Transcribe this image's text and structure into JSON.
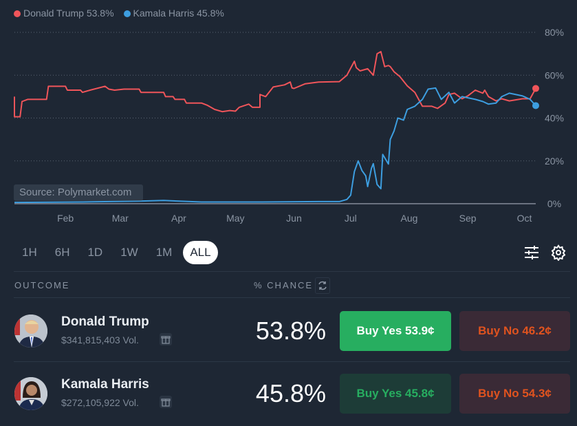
{
  "legend": [
    {
      "label": "Donald Trump 53.8%",
      "color": "#f0555a"
    },
    {
      "label": "Kamala Harris 45.8%",
      "color": "#3d9ee0"
    }
  ],
  "source": "Source: Polymarket.com",
  "chart_data": {
    "type": "line",
    "ylim": [
      0,
      80
    ],
    "yticks": [
      "0%",
      "20%",
      "40%",
      "60%",
      "80%"
    ],
    "ytick_values": [
      0,
      20,
      40,
      60,
      80
    ],
    "xticks": [
      "Feb",
      "Mar",
      "Apr",
      "May",
      "Jun",
      "Jul",
      "Aug",
      "Sep",
      "Oct"
    ],
    "xtick_dates": [
      "2024-02-01",
      "2024-03-01",
      "2024-04-01",
      "2024-05-01",
      "2024-06-01",
      "2024-07-01",
      "2024-08-01",
      "2024-09-01",
      "2024-10-01"
    ],
    "xlim": [
      "2024-01-05",
      "2024-10-07"
    ],
    "grid": true,
    "legend_position": "top-left",
    "series": [
      {
        "name": "Donald Trump",
        "color": "#f0555a",
        "points": [
          [
            "2024-01-05",
            50
          ],
          [
            "2024-01-05",
            40.6
          ],
          [
            "2024-01-08",
            40.6
          ],
          [
            "2024-01-09",
            47.7
          ],
          [
            "2024-01-12",
            48.7
          ],
          [
            "2024-01-22",
            48.7
          ],
          [
            "2024-01-23",
            54.8
          ],
          [
            "2024-02-01",
            54.8
          ],
          [
            "2024-02-02",
            53
          ],
          [
            "2024-02-09",
            53
          ],
          [
            "2024-02-10",
            52
          ],
          [
            "2024-02-14",
            53
          ],
          [
            "2024-02-22",
            54.8
          ],
          [
            "2024-02-24",
            53.5
          ],
          [
            "2024-02-27",
            53
          ],
          [
            "2024-03-03",
            53.5
          ],
          [
            "2024-03-11",
            53.5
          ],
          [
            "2024-03-12",
            52
          ],
          [
            "2024-03-24",
            52
          ],
          [
            "2024-03-25",
            50
          ],
          [
            "2024-03-29",
            50
          ],
          [
            "2024-03-30",
            48.7
          ],
          [
            "2024-04-04",
            48.7
          ],
          [
            "2024-04-05",
            47
          ],
          [
            "2024-04-13",
            47
          ],
          [
            "2024-04-16",
            46
          ],
          [
            "2024-04-20",
            44
          ],
          [
            "2024-04-24",
            43
          ],
          [
            "2024-04-28",
            43.5
          ],
          [
            "2024-05-01",
            43.2
          ],
          [
            "2024-05-03",
            45
          ],
          [
            "2024-05-08",
            46.5
          ],
          [
            "2024-05-10",
            45
          ],
          [
            "2024-05-14",
            45
          ],
          [
            "2024-05-14",
            51
          ],
          [
            "2024-05-17",
            50
          ],
          [
            "2024-05-21",
            54.5
          ],
          [
            "2024-05-27",
            55.5
          ],
          [
            "2024-05-30",
            56.8
          ],
          [
            "2024-05-31",
            54
          ],
          [
            "2024-06-01",
            53.8
          ],
          [
            "2024-06-07",
            56
          ],
          [
            "2024-06-14",
            56.8
          ],
          [
            "2024-06-25",
            57
          ],
          [
            "2024-06-29",
            60
          ],
          [
            "2024-07-03",
            66.5
          ],
          [
            "2024-07-04",
            63.5
          ],
          [
            "2024-07-06",
            62
          ],
          [
            "2024-07-10",
            63
          ],
          [
            "2024-07-13",
            60
          ],
          [
            "2024-07-15",
            70
          ],
          [
            "2024-07-17",
            71
          ],
          [
            "2024-07-19",
            64
          ],
          [
            "2024-07-21",
            64.5
          ],
          [
            "2024-07-22",
            64
          ],
          [
            "2024-07-24",
            61.6
          ],
          [
            "2024-07-27",
            59.4
          ],
          [
            "2024-07-31",
            55
          ],
          [
            "2024-08-04",
            52
          ],
          [
            "2024-08-08",
            45.5
          ],
          [
            "2024-08-13",
            45.5
          ],
          [
            "2024-08-16",
            44.5
          ],
          [
            "2024-08-20",
            47
          ],
          [
            "2024-08-22",
            51
          ],
          [
            "2024-08-25",
            51.6
          ],
          [
            "2024-08-29",
            49
          ],
          [
            "2024-09-01",
            50.3
          ],
          [
            "2024-09-05",
            53
          ],
          [
            "2024-09-09",
            51.6
          ],
          [
            "2024-09-10",
            53
          ],
          [
            "2024-09-12",
            50
          ],
          [
            "2024-09-16",
            48
          ],
          [
            "2024-09-19",
            49
          ],
          [
            "2024-09-23",
            48
          ],
          [
            "2024-09-30",
            49
          ],
          [
            "2024-10-04",
            49
          ],
          [
            "2024-10-07",
            53.8
          ]
        ]
      },
      {
        "name": "Kamala Harris",
        "color": "#3d9ee0",
        "points": [
          [
            "2024-01-05",
            0.6
          ],
          [
            "2024-02-10",
            0.8
          ],
          [
            "2024-03-11",
            1.2
          ],
          [
            "2024-03-24",
            1.5
          ],
          [
            "2024-04-13",
            0.8
          ],
          [
            "2024-05-14",
            0.8
          ],
          [
            "2024-06-14",
            1
          ],
          [
            "2024-06-25",
            1
          ],
          [
            "2024-06-29",
            2
          ],
          [
            "2024-07-01",
            4
          ],
          [
            "2024-07-03",
            15
          ],
          [
            "2024-07-05",
            20
          ],
          [
            "2024-07-07",
            15.5
          ],
          [
            "2024-07-09",
            13
          ],
          [
            "2024-07-10",
            8
          ],
          [
            "2024-07-12",
            16.5
          ],
          [
            "2024-07-13",
            18.7
          ],
          [
            "2024-07-15",
            9
          ],
          [
            "2024-07-17",
            7
          ],
          [
            "2024-07-18",
            23
          ],
          [
            "2024-07-21",
            18.5
          ],
          [
            "2024-07-22",
            30
          ],
          [
            "2024-07-24",
            34
          ],
          [
            "2024-07-26",
            40
          ],
          [
            "2024-07-29",
            39
          ],
          [
            "2024-07-31",
            44
          ],
          [
            "2024-08-04",
            45.5
          ],
          [
            "2024-08-08",
            48.7
          ],
          [
            "2024-08-11",
            53.5
          ],
          [
            "2024-08-15",
            54
          ],
          [
            "2024-08-18",
            48.7
          ],
          [
            "2024-08-22",
            52
          ],
          [
            "2024-08-25",
            47
          ],
          [
            "2024-08-29",
            50
          ],
          [
            "2024-09-05",
            48.7
          ],
          [
            "2024-09-09",
            47.7
          ],
          [
            "2024-09-12",
            46.5
          ],
          [
            "2024-09-16",
            47
          ],
          [
            "2024-09-19",
            50
          ],
          [
            "2024-09-23",
            51.6
          ],
          [
            "2024-09-30",
            50.3
          ],
          [
            "2024-10-04",
            48.7
          ],
          [
            "2024-10-07",
            45.8
          ]
        ]
      }
    ]
  },
  "ranges": [
    "1H",
    "6H",
    "1D",
    "1W",
    "1M",
    "ALL"
  ],
  "active_range": "ALL",
  "icons": {
    "filters": "sliders-icon",
    "settings": "gear-icon",
    "refresh": "refresh-icon",
    "gift": "gift-icon"
  },
  "table": {
    "outcome_header": "OUTCOME",
    "chance_header": "% CHANCE",
    "rows": [
      {
        "name": "Donald Trump",
        "volume": "$341,815,403 Vol.",
        "chance": "53.8%",
        "buy_yes": "Buy Yes 53.9¢",
        "buy_no": "Buy No 46.2¢",
        "yes_active": true
      },
      {
        "name": "Kamala Harris",
        "volume": "$272,105,922 Vol.",
        "chance": "45.8%",
        "buy_yes": "Buy Yes 45.8¢",
        "buy_no": "Buy No 54.3¢",
        "yes_active": false
      }
    ]
  },
  "colors": {
    "background": "#1e2734",
    "yes_active": "#27ae60",
    "yes_inactive_bg": "#1d3c37",
    "no_bg": "#3a2a36",
    "no_text": "#e0531f"
  }
}
